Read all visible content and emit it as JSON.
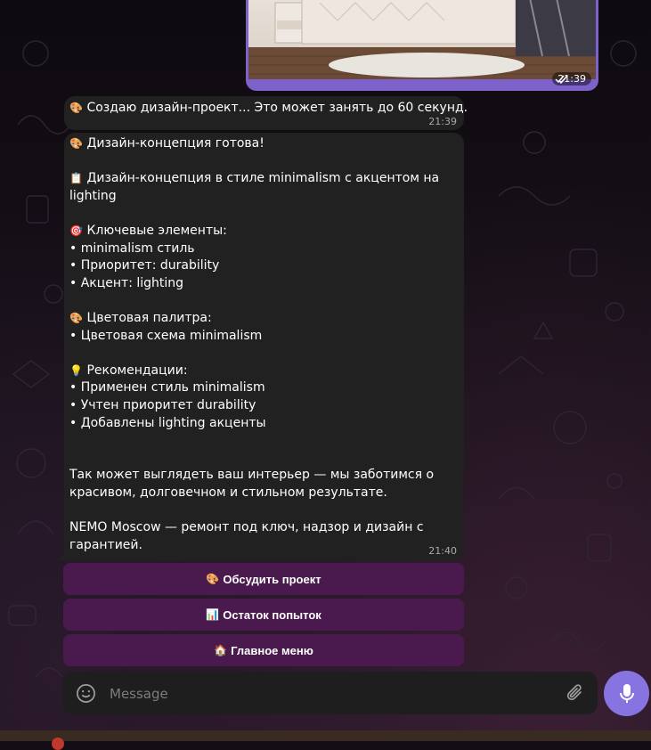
{
  "messages": {
    "photo": {
      "time": "21:39",
      "status_icon": "double-check-icon"
    },
    "status": {
      "emoji": "🎨",
      "text": "Создаю дизайн-проект... Это может занять до 60 секунд.",
      "time": "21:39"
    },
    "concept": {
      "time": "21:40",
      "lines": [
        {
          "emoji": "🎨",
          "text": "Дизайн-концепция готова!"
        },
        {
          "emoji": "",
          "text": ""
        },
        {
          "emoji": "📋",
          "text": "Дизайн-концепция в стиле minimalism с акцентом на lighting"
        },
        {
          "emoji": "",
          "text": ""
        },
        {
          "emoji": "🎯",
          "text": "Ключевые элементы:"
        },
        {
          "emoji": "",
          "text": "• minimalism стиль"
        },
        {
          "emoji": "",
          "text": "• Приоритет: durability"
        },
        {
          "emoji": "",
          "text": "• Акцент: lighting"
        },
        {
          "emoji": "",
          "text": ""
        },
        {
          "emoji": "🎨",
          "text": "Цветовая палитра:"
        },
        {
          "emoji": "",
          "text": "• Цветовая схема minimalism"
        },
        {
          "emoji": "",
          "text": ""
        },
        {
          "emoji": "💡",
          "text": "Рекомендации:"
        },
        {
          "emoji": "",
          "text": "• Применен стиль minimalism"
        },
        {
          "emoji": "",
          "text": "• Учтен приоритет durability"
        },
        {
          "emoji": "",
          "text": "• Добавлены lighting акценты"
        },
        {
          "emoji": "",
          "text": ""
        },
        {
          "emoji": "",
          "text": ""
        },
        {
          "emoji": "",
          "text": "Так может выглядеть ваш интерьер — мы заботимся о красивом, долговечном и стильном результате."
        },
        {
          "emoji": "",
          "text": ""
        },
        {
          "emoji": "",
          "text": "NEMO Moscow — ремонт под ключ, надзор и дизайн с гарантией."
        }
      ]
    }
  },
  "keyboard": {
    "buttons": [
      {
        "emoji": "🎨",
        "label": "Обсудить проект"
      },
      {
        "emoji": "📊",
        "label": "Остаток попыток"
      },
      {
        "emoji": "🏠",
        "label": "Главное меню"
      }
    ]
  },
  "composer": {
    "placeholder": "Message",
    "emoji_icon": "smile-icon",
    "attach_icon": "paperclip-icon",
    "send_icon": "microphone-icon"
  },
  "colors": {
    "accent": "#8774e1",
    "outgoing_bubble": "#7d62cc",
    "incoming_bubble": "#212121",
    "keyboard_button": "#4a1a4f"
  }
}
